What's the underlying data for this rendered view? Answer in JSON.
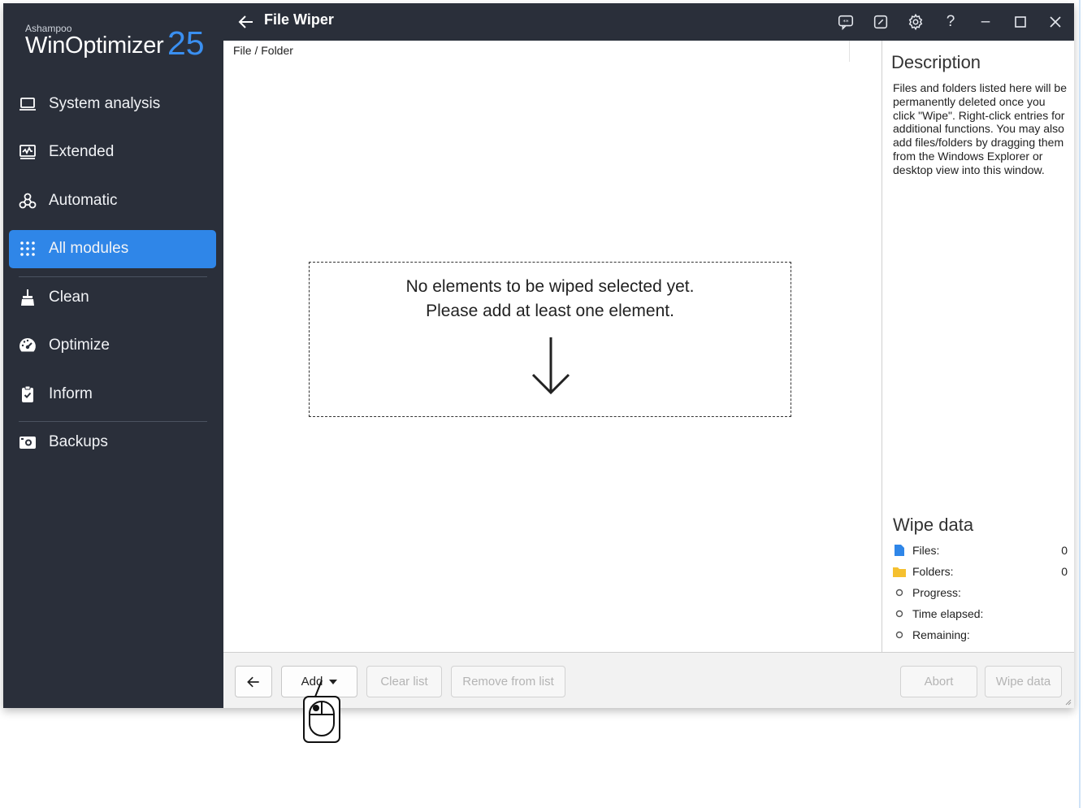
{
  "app": {
    "brand_small": "Ashampoo",
    "brand_main": "WinOptimizer",
    "brand_version": "25",
    "accent_color": "#2f86e8",
    "sidebar_color": "#2a2f3a"
  },
  "sidebar": {
    "items": [
      {
        "label": "System analysis",
        "icon": "laptop-icon",
        "active": false
      },
      {
        "label": "Extended",
        "icon": "monitor-chart-icon",
        "active": false
      },
      {
        "label": "Automatic",
        "icon": "automation-icon",
        "active": false
      },
      {
        "label": "All modules",
        "icon": "grid-dots-icon",
        "active": true
      },
      {
        "label": "Clean",
        "icon": "broom-icon",
        "active": false
      },
      {
        "label": "Optimize",
        "icon": "speedometer-icon",
        "active": false
      },
      {
        "label": "Inform",
        "icon": "clipboard-check-icon",
        "active": false
      },
      {
        "label": "Backups",
        "icon": "camera-icon",
        "active": false
      }
    ]
  },
  "titlebar": {
    "title": "File Wiper",
    "icons": [
      "feedback-icon",
      "note-icon",
      "settings-gear-icon",
      "help-icon",
      "minimize-icon",
      "maximize-icon",
      "close-icon"
    ],
    "help_glyph": "?",
    "minimize_glyph": "–",
    "maximize_glyph": "☐",
    "close_glyph": "✕"
  },
  "content": {
    "column_header": "File / Folder",
    "empty_line1": "No elements to be wiped selected yet.",
    "empty_line2": "Please add at least one element."
  },
  "right_panel": {
    "description_title": "Description",
    "description_text": "Files and folders listed here will be permanently deleted once you click \"Wipe\". Right-click entries for additional functions. You may also add files/folders by dragging them from the Windows Explorer or desktop view into this window.",
    "wipe_title": "Wipe data",
    "stats": [
      {
        "label": "Files:",
        "value": "0",
        "icon": "file-icon"
      },
      {
        "label": "Folders:",
        "value": "0",
        "icon": "folder-icon"
      },
      {
        "label": "Progress:",
        "value": "",
        "icon": "circle-bullet-icon"
      },
      {
        "label": "Time elapsed:",
        "value": "",
        "icon": "circle-bullet-icon"
      },
      {
        "label": "Remaining:",
        "value": "",
        "icon": "circle-bullet-icon"
      }
    ]
  },
  "bottombar": {
    "add_label": "Add",
    "clear_label": "Clear list",
    "remove_label": "Remove from list",
    "abort_label": "Abort",
    "wipe_label": "Wipe data"
  }
}
